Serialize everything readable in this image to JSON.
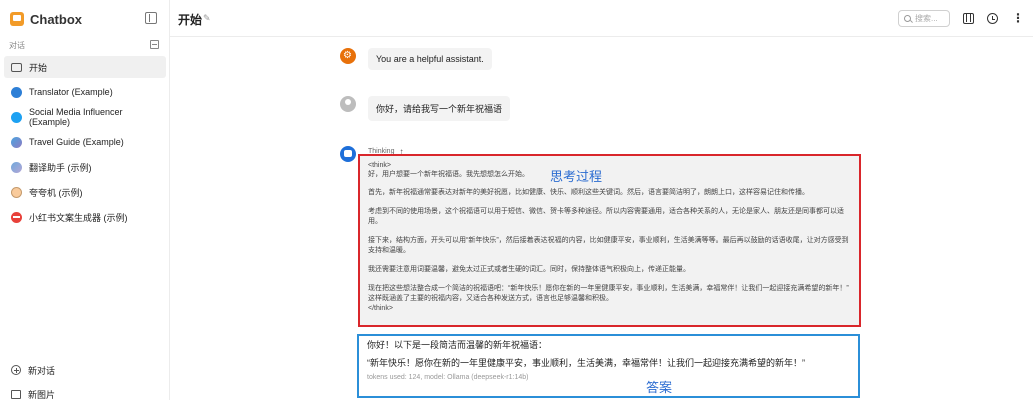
{
  "app": {
    "name": "Chatbox"
  },
  "sidebar": {
    "section_label": "对话",
    "items": [
      {
        "label": "开始",
        "icon": "chat-icon"
      },
      {
        "label": "Translator (Example)",
        "icon": "avatar-icon"
      },
      {
        "label": "Social Media Influencer (Example)",
        "icon": "twitter-icon"
      },
      {
        "label": "Travel Guide (Example)",
        "icon": "globe-icon"
      },
      {
        "label": "翻译助手 (示例)",
        "icon": "robot-icon"
      },
      {
        "label": "夸夸机 (示例)",
        "icon": "bulb-icon"
      },
      {
        "label": "小红书文案生成器 (示例)",
        "icon": "red-icon"
      }
    ],
    "new_chat": "新对话",
    "new_image": "新图片"
  },
  "header": {
    "title": "开始",
    "search_placeholder": "搜索..."
  },
  "messages": {
    "system": "You are a helpful assistant.",
    "user": "你好，请给我写一个新年祝福语"
  },
  "assistant": {
    "thinking_label": "Thinking",
    "think_open": "<think>",
    "think_first": "好，用户想要一个新年祝福语。我先想想怎么开始。",
    "paragraphs": [
      "首先，新年祝福通常要表达对新年的美好祝愿，比如健康、快乐、顺利这些关键词。然后，语言要简洁明了，朗朗上口，这样容易记住和传播。",
      "考虑到不同的使用场景，这个祝福语可以用于短信、微信、贺卡等多种途径。所以内容需要通用，适合各种关系的人，无论是家人、朋友还是同事都可以适用。",
      "接下来，结构方面，开头可以用“新年快乐”，然后接着表达祝福的内容，比如健康平安，事业顺利，生活美满等等。最后再以鼓励的话语收尾，让对方感受到支持和温暖。",
      "我还需要注意用词要温馨，避免太过正式或者生硬的词汇。同时，保持整体语气积极向上，传递正能量。",
      "现在把这些想法整合成一个简洁的祝福语吧：“新年快乐！愿你在新的一年里健康平安，事业顺利，生活美满，幸福常伴！让我们一起迎接充满希望的新年！” 这样既涵盖了主要的祝福内容，又适合各种发送方式，语言也足够温馨和积极。"
    ],
    "think_close": "</think>",
    "answer_intro": "你好！以下是一段简洁而温馨的新年祝福语：",
    "answer_text": "“新年快乐！愿你在新的一年里健康平安，事业顺利，生活美满，幸福常伴！让我们一起迎接充满希望的新年！”",
    "token_info": "tokens used: 124, model: Ollama (deepseek-r1:14b)"
  },
  "annotations": {
    "thinking_process": "思考过程",
    "answer": "答案"
  },
  "colors": {
    "thinking_border": "#d9262b",
    "answer_border": "#2b8fd8",
    "annotation_text": "#2b6cd1"
  }
}
